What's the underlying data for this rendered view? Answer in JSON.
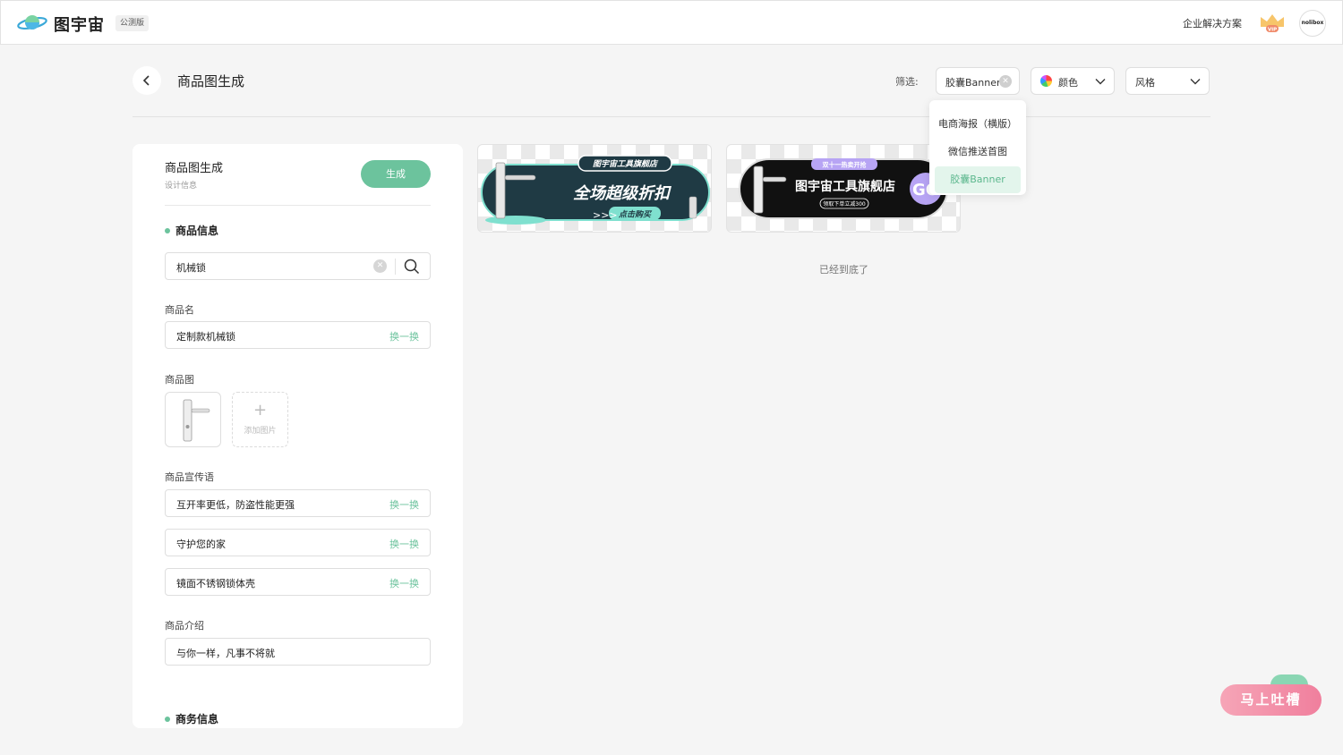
{
  "app": {
    "brand": "图宇宙",
    "beta_badge": "公测版",
    "enterprise_link": "企业解决方案",
    "vip_label": "VIP",
    "avatar_text": "nolibox"
  },
  "page": {
    "title": "商品图生成",
    "filter_label": "筛选:",
    "filters": {
      "size": "胶囊Banner",
      "color": "颜色",
      "style": "风格"
    },
    "dropdown_options": [
      {
        "label": "电商海报（横版）",
        "active": false
      },
      {
        "label": "微信推送首图",
        "active": false
      },
      {
        "label": "胶囊Banner",
        "active": true
      }
    ],
    "end_text": "已经到底了"
  },
  "panel": {
    "title": "商品图生成",
    "subtitle": "设计信息",
    "generate_label": "生成",
    "product_section": "商品信息",
    "search_value": "机械锁",
    "name_label": "商品名",
    "name_value": "定制款机械锁",
    "swap_label": "换一换",
    "image_label": "商品图",
    "add_image_label": "添加图片",
    "slogan_label": "商品宣传语",
    "slogans": [
      "互开率更低，防盗性能更强",
      "守护您的家",
      "镜面不锈钢锁体壳"
    ],
    "intro_label": "商品介绍",
    "intro_value": "与你一样，凡事不将就",
    "business_section": "商务信息"
  },
  "cards": [
    {
      "top_tag": "图宇宙工具旗舰店",
      "headline": "全场超级折扣",
      "cta": "点击购买",
      "colors": {
        "dark": "#1f3a44",
        "accent": "#7fe0cf"
      }
    },
    {
      "top_tag": "双十一热卖开抢",
      "headline": "图宇宙工具旗舰店",
      "sub": "领取下单立减300",
      "go": "GO",
      "colors": {
        "dark": "#111111",
        "accent": "#b7a4f4"
      }
    }
  ],
  "feedback": "马上吐槽",
  "colors": {
    "primary": "#6cc39d",
    "page_bg": "#f5f5f5"
  }
}
